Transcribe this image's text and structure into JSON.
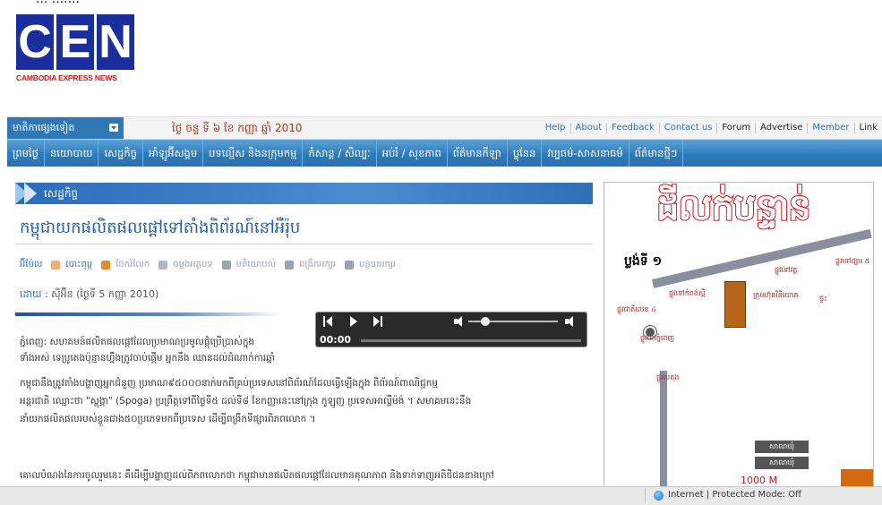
{
  "logo": {
    "letters": [
      "C",
      "E",
      "N"
    ],
    "tagline": "CAMBODIA EXPRESS NEWS"
  },
  "topbar": {
    "dropdown_label": "មាតិកាផ្សេងទៀត",
    "date": "ថ្ងៃ ចន្ទ ទី ៦ ខែ កញ្ញា ឆ្នាំ 2010",
    "links": [
      "Help",
      "About",
      "Feedback",
      "Contact us",
      "Forum",
      "Advertise",
      "Member",
      "Link"
    ]
  },
  "nav": {
    "items": [
      "ព្រមថ្ងៃ",
      "នយោបាយ",
      "សេដ្ឋកិច្ច",
      "អាំឡូអ៊ីសង្គម",
      "បទល្មើស និងនក្រុមកម្ម",
      "កំសាន្ត / សិល្បៈ",
      "អប់រំ / សុខភាព",
      "ព័ត៌មានកីឡា",
      "ប្លុនែន",
      "វប្បធម៌-សាសនាធម៌",
      "ព័ត៌មានថ្មីៗ"
    ]
  },
  "article": {
    "section": "សេដ្ឋកិច្ច",
    "headline": "កម្ពុជាយកផលិតផលផ្តៅទៅតាំងពិព័រណ៍នៅអឺរ៉ុប",
    "tools": [
      "អ៊ីម៉ែល",
      "បោះពុម្ព",
      "ចែករំលែក",
      "ចម្លងអត្ថបទ",
      "មតិយោបល់",
      "ពង្រីកអក្សរ",
      "បន្ថយអក្សរ"
    ],
    "byline_key": "ដោយ",
    "byline_value": ": សុីអ៊ីន (ថ្ងៃទី 5 កញ្ញា 2010)",
    "player_time": "00:00",
    "body_key": "ភ្នំពេញ:",
    "body_lines": [
      "ភ្នំពេញ: សហគមន៍ផលិតផលផ្តៅដែលប្រមាណប្រមូលផ្តុំប្រើប្រាស់ក្នុង",
      "ទាំងអស់ ទេប្រូតេងប៉ុន្មានហ្នឹងត្រូវចាប់ផ្តើម អ្នកនឹង ឈានដល់ដំណាក់ការឆ្នាំ",
      "កម្ពុជានឹងត្រូវតាំងបង្ហាញអ្នកជំនួញ ប្រមាណ៩៥០០០នាក់មកពីគ្រប់ប្រទេសនៅពិព័រណ៍ដែលធ្វើឡើងក្នុង ពិព័រណ៍ពាណិជ្ជកម្ម",
      "អន្តរជាតិ ឈ្មោះថា \"ស្ពុង្គា\" (Spoga) ប្រព្រឹត្តទៅពីថ្ងៃទី៥ ដល់ទី៨ ខែកញ្ញានេះនៅក្រុង កូឡូញ ប្រទេសអាល្លឺម៉ង់ ។ សមាគមនេះនឹង",
      "នាំយកផលិតផលរបស់ខ្លួនជាង៥០ប្រភេទមកពីប្រទេស ដើម្បីពង្រីកទីផ្សារពិភពលោក ។",
      "   គោលបំណងនៃការចូលរួមនេះ គឺដើម្បីបង្ហាញដល់ពិភពលោកថា កម្ពុជាមានផលិតផលផ្តៅដែលមានគុណភាព និងទាក់ទាញអតិថិជនខាងក្រៅ"
    ]
  },
  "ad": {
    "title": "ដីលក់បន្ទាន់",
    "map_label": "ប្លង់ទី ១",
    "labels": [
      "ផ្លូវទៅផ្សារ ៥",
      "ផ្លូវទៅវត្ត",
      "ផ្លូវជាតិលេខ ៤",
      "ផ្លូវទៅកំពង់ស្ពឺ",
      "ផ្លូវទៅភ្នំពេញ",
      "ក្រុមហ៊ុនវិនិយោគ",
      "ផ្ទះ",
      "ផ្លូវបេតុង"
    ],
    "boxes": [
      "សាលាឃុំ",
      "សាលាឃុំ"
    ],
    "scale": "1000 M"
  },
  "status": {
    "text": "Internet | Protected Mode: Off"
  }
}
